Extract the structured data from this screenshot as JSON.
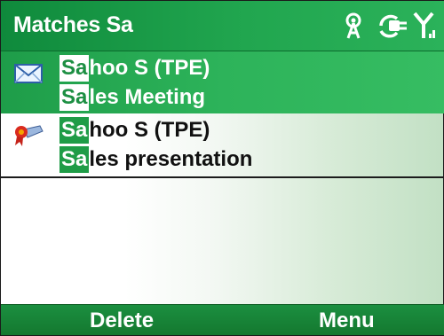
{
  "header": {
    "title": "Matches Sa",
    "icons": [
      "signal-tower-icon",
      "sync-plug-icon",
      "signal-strength-icon"
    ]
  },
  "results": [
    {
      "type": "email",
      "icon": "email-icon",
      "selected": true,
      "line1": {
        "match": "Sa",
        "rest": "hoo S (TPE)"
      },
      "line2": {
        "match": "Sa",
        "rest": "les Meeting"
      }
    },
    {
      "type": "task",
      "icon": "task-ribbon-icon",
      "selected": false,
      "line1": {
        "match": "Sa",
        "rest": "hoo S (TPE)"
      },
      "line2": {
        "match": "Sa",
        "rest": "les presentation"
      }
    }
  ],
  "softkeys": {
    "left": "Delete",
    "right": "Menu"
  },
  "colors": {
    "accent": "#21a64f",
    "highlight_text": "#1d8f43"
  }
}
